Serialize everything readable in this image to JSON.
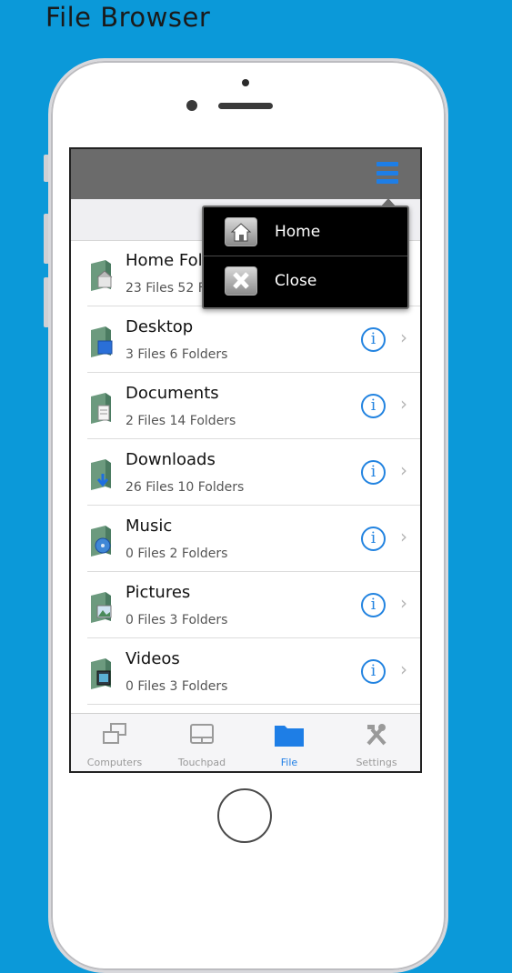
{
  "caption": "File Browser",
  "colors": {
    "background": "#0b99d9",
    "accent": "#1e7ee6",
    "topbar": "#6b6b6b"
  },
  "menu": {
    "items": [
      {
        "label": "Home",
        "icon": "home-icon"
      },
      {
        "label": "Close",
        "icon": "close-icon"
      }
    ]
  },
  "folders": [
    {
      "name": "Home Fol",
      "meta": "23 Files 52 F",
      "icon": "home-folder-icon"
    },
    {
      "name": "Desktop",
      "meta": "3 Files 6 Folders",
      "icon": "desktop-folder-icon"
    },
    {
      "name": "Documents",
      "meta": "2 Files 14 Folders",
      "icon": "documents-folder-icon"
    },
    {
      "name": "Downloads",
      "meta": "26 Files 10 Folders",
      "icon": "downloads-folder-icon"
    },
    {
      "name": "Music",
      "meta": "0 Files 2 Folders",
      "icon": "music-folder-icon"
    },
    {
      "name": "Pictures",
      "meta": "0 Files 3 Folders",
      "icon": "pictures-folder-icon"
    },
    {
      "name": "Videos",
      "meta": "0 Files 3 Folders",
      "icon": "videos-folder-icon"
    }
  ],
  "tabs": [
    {
      "label": "Computers",
      "icon": "computers-icon",
      "active": false
    },
    {
      "label": "Touchpad",
      "icon": "touchpad-icon",
      "active": false
    },
    {
      "label": "File",
      "icon": "folder-icon",
      "active": true
    },
    {
      "label": "Settings",
      "icon": "settings-tools-icon",
      "active": false
    }
  ]
}
